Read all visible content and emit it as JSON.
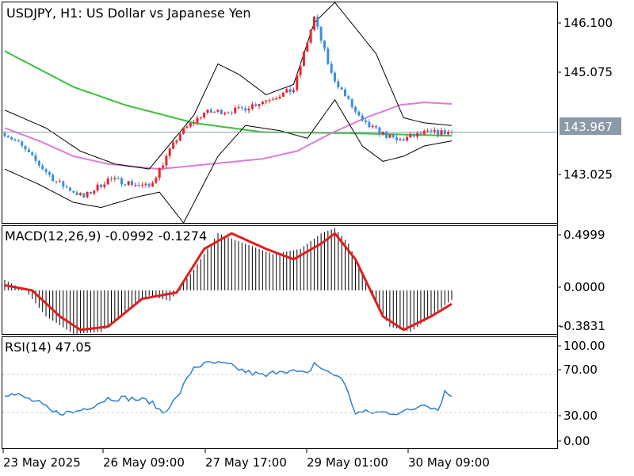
{
  "chart_data": [
    {
      "type": "candlestick",
      "symbol": "USDJPY",
      "timeframe": "H1",
      "description": "US Dollar vs Japanese Yen",
      "title": "USDJPY, H1:  US Dollar vs Japanese Yen",
      "price_ticks": [
        "146.100",
        "145.075",
        "143.025"
      ],
      "ylim": [
        142.2,
        146.5
      ],
      "current_price": "143.967",
      "colors": {
        "bull": "#e8252b",
        "bear": "#3a8fe0",
        "ma_slow": "#3cbf3c",
        "ma_fast": "#e07ad8",
        "bands": "#000000",
        "price_line": "#8a9aa8"
      },
      "series_anchor_points": {
        "close": [
          [
            0,
            143.95
          ],
          [
            4,
            143.75
          ],
          [
            9,
            143.4
          ],
          [
            15,
            143.0
          ],
          [
            23,
            142.7
          ],
          [
            30,
            143.05
          ],
          [
            35,
            143.0
          ],
          [
            42,
            142.9
          ],
          [
            51,
            143.95
          ],
          [
            58,
            144.35
          ],
          [
            68,
            144.4
          ],
          [
            76,
            144.6
          ],
          [
            84,
            144.8
          ],
          [
            90,
            146.2
          ],
          [
            95,
            145.1
          ],
          [
            104,
            144.15
          ],
          [
            114,
            143.8
          ],
          [
            122,
            143.95
          ],
          [
            130,
            143.97
          ]
        ],
        "upper_band": [
          [
            0,
            144.4
          ],
          [
            12,
            144.05
          ],
          [
            22,
            143.6
          ],
          [
            32,
            143.35
          ],
          [
            42,
            143.25
          ],
          [
            55,
            144.3
          ],
          [
            62,
            145.3
          ],
          [
            68,
            145.1
          ],
          [
            76,
            144.7
          ],
          [
            84,
            144.9
          ],
          [
            90,
            146.1
          ],
          [
            96,
            146.5
          ],
          [
            108,
            145.5
          ],
          [
            116,
            144.25
          ],
          [
            122,
            144.15
          ],
          [
            130,
            144.1
          ]
        ],
        "lower_band": [
          [
            0,
            143.25
          ],
          [
            10,
            142.95
          ],
          [
            20,
            142.6
          ],
          [
            28,
            142.5
          ],
          [
            38,
            142.7
          ],
          [
            45,
            142.8
          ],
          [
            52,
            142.2
          ],
          [
            62,
            143.5
          ],
          [
            70,
            144.1
          ],
          [
            80,
            144.0
          ],
          [
            88,
            143.85
          ],
          [
            96,
            144.6
          ],
          [
            104,
            143.7
          ],
          [
            110,
            143.4
          ],
          [
            116,
            143.5
          ],
          [
            122,
            143.7
          ],
          [
            130,
            143.8
          ]
        ],
        "ma_slow": [
          [
            0,
            145.55
          ],
          [
            10,
            145.2
          ],
          [
            20,
            144.85
          ],
          [
            35,
            144.5
          ],
          [
            55,
            144.15
          ],
          [
            75,
            143.97
          ],
          [
            100,
            143.95
          ],
          [
            130,
            143.9
          ]
        ],
        "ma_fast": [
          [
            0,
            144.05
          ],
          [
            10,
            143.8
          ],
          [
            20,
            143.5
          ],
          [
            30,
            143.35
          ],
          [
            45,
            143.25
          ],
          [
            60,
            143.35
          ],
          [
            75,
            143.45
          ],
          [
            85,
            143.6
          ],
          [
            95,
            143.95
          ],
          [
            105,
            144.25
          ],
          [
            115,
            144.5
          ],
          [
            122,
            144.55
          ],
          [
            130,
            144.52
          ]
        ]
      }
    },
    {
      "type": "histogram+line",
      "indicator": "MACD(12,26,9)",
      "label": "MACD(12,26,9) -0.0992 -0.1274",
      "ticks": [
        "0.4999",
        "0.0000",
        "-0.3831"
      ],
      "ylim": [
        -0.42,
        0.62
      ],
      "colors": {
        "histogram": "#000000",
        "signal": "#e01e1e"
      },
      "histogram_anchor_points": [
        [
          0,
          0.1
        ],
        [
          6,
          0.0
        ],
        [
          12,
          -0.25
        ],
        [
          20,
          -0.42
        ],
        [
          28,
          -0.4
        ],
        [
          35,
          -0.2
        ],
        [
          42,
          -0.05
        ],
        [
          48,
          -0.1
        ],
        [
          55,
          0.2
        ],
        [
          62,
          0.55
        ],
        [
          70,
          0.45
        ],
        [
          78,
          0.35
        ],
        [
          86,
          0.4
        ],
        [
          92,
          0.55
        ],
        [
          96,
          0.6
        ],
        [
          100,
          0.45
        ],
        [
          106,
          0.0
        ],
        [
          112,
          -0.35
        ],
        [
          118,
          -0.4
        ],
        [
          124,
          -0.25
        ],
        [
          130,
          -0.09
        ]
      ],
      "signal_anchor_points": [
        [
          0,
          0.05
        ],
        [
          8,
          0.0
        ],
        [
          16,
          -0.25
        ],
        [
          22,
          -0.38
        ],
        [
          30,
          -0.35
        ],
        [
          40,
          -0.08
        ],
        [
          50,
          -0.02
        ],
        [
          58,
          0.4
        ],
        [
          66,
          0.55
        ],
        [
          76,
          0.4
        ],
        [
          84,
          0.3
        ],
        [
          92,
          0.45
        ],
        [
          96,
          0.55
        ],
        [
          102,
          0.3
        ],
        [
          110,
          -0.25
        ],
        [
          116,
          -0.38
        ],
        [
          124,
          -0.25
        ],
        [
          130,
          -0.13
        ]
      ]
    },
    {
      "type": "line",
      "indicator": "RSI(14)",
      "label": "RSI(14) 47.05",
      "ticks": [
        "100.00",
        "70.00",
        "30.00",
        "0.00"
      ],
      "ylim": [
        0,
        100
      ],
      "colors": {
        "line": "#2b7fd4"
      },
      "anchor_points": [
        [
          0,
          50
        ],
        [
          4,
          48
        ],
        [
          10,
          40
        ],
        [
          14,
          30
        ],
        [
          20,
          30
        ],
        [
          26,
          38
        ],
        [
          30,
          45
        ],
        [
          36,
          45
        ],
        [
          42,
          42
        ],
        [
          46,
          30
        ],
        [
          50,
          45
        ],
        [
          55,
          78
        ],
        [
          60,
          82
        ],
        [
          65,
          80
        ],
        [
          70,
          73
        ],
        [
          76,
          68
        ],
        [
          80,
          75
        ],
        [
          84,
          73
        ],
        [
          88,
          70
        ],
        [
          90,
          82
        ],
        [
          94,
          72
        ],
        [
          98,
          67
        ],
        [
          102,
          30
        ],
        [
          108,
          30
        ],
        [
          114,
          30
        ],
        [
          118,
          32
        ],
        [
          122,
          40
        ],
        [
          126,
          33
        ],
        [
          128,
          52
        ],
        [
          130,
          47
        ]
      ]
    }
  ],
  "time_axis": [
    "23 May 2025",
    "26 May 09:00",
    "27 May 17:00",
    "29 May 01:00",
    "30 May 09:00"
  ]
}
